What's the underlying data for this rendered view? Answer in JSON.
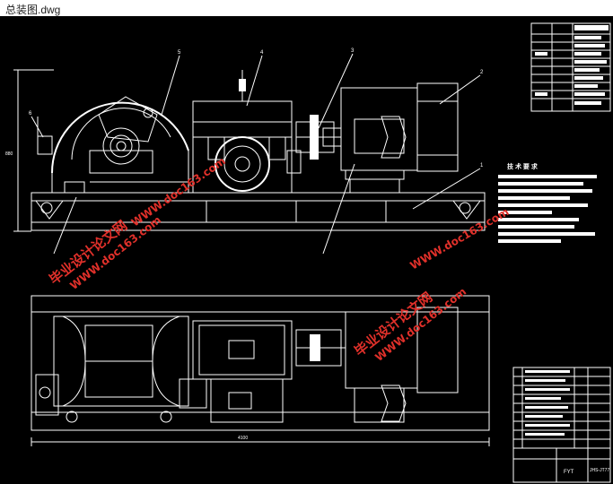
{
  "window": {
    "title": "总装图.dwg"
  },
  "drawing": {
    "background": "#000000",
    "line_color": "#ffffff",
    "watermark_color": "#e0302a",
    "part_callouts": [
      "5",
      "4",
      "3",
      "2",
      "1",
      "6"
    ],
    "tech_requirements_title": "技 术 要 求",
    "dims": {
      "overall_length": "4100",
      "overall_height": "880"
    },
    "title_block": {
      "drawing_no": "JHS-JT77",
      "unit": "FYT"
    }
  },
  "watermarks": [
    {
      "cn": "毕业设计论文网",
      "url": "WWW.doc163.com"
    },
    {
      "cn": "毕业设计论文网",
      "url": "WWW.doc163.com"
    },
    {
      "cn": "毕业设计论文网",
      "url": "WWW.doc163.com"
    }
  ]
}
